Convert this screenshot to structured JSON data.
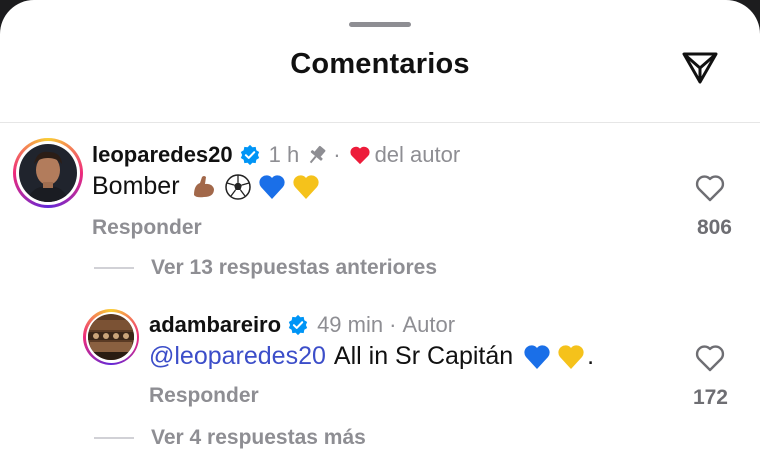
{
  "header": {
    "title": "Comentarios"
  },
  "comments": [
    {
      "username": "leoparedes20",
      "time": "1 h",
      "pin_dot": "·",
      "liked_by": "del autor",
      "text": "Bomber",
      "emojis": [
        "flexed-biceps",
        "soccer-ball",
        "blue-heart",
        "yellow-heart"
      ],
      "reply_label": "Responder",
      "likes": "806",
      "thread_label": "Ver 13 respuestas anteriores"
    },
    {
      "username": "adambareiro",
      "time": "49 min",
      "sep": "·",
      "author_tag": "Autor",
      "mention": "@leoparedes20",
      "text": "All in Sr Capitán",
      "emojis": [
        "blue-heart",
        "yellow-heart"
      ],
      "trailing": ".",
      "reply_label": "Responder",
      "likes": "172",
      "thread_label": "Ver 4 respuestas más"
    }
  ],
  "colors": {
    "verified": "#0095f6",
    "heart": "#ed1c3a",
    "mention": "#3c4ec9",
    "muted": "#8e8e93"
  }
}
